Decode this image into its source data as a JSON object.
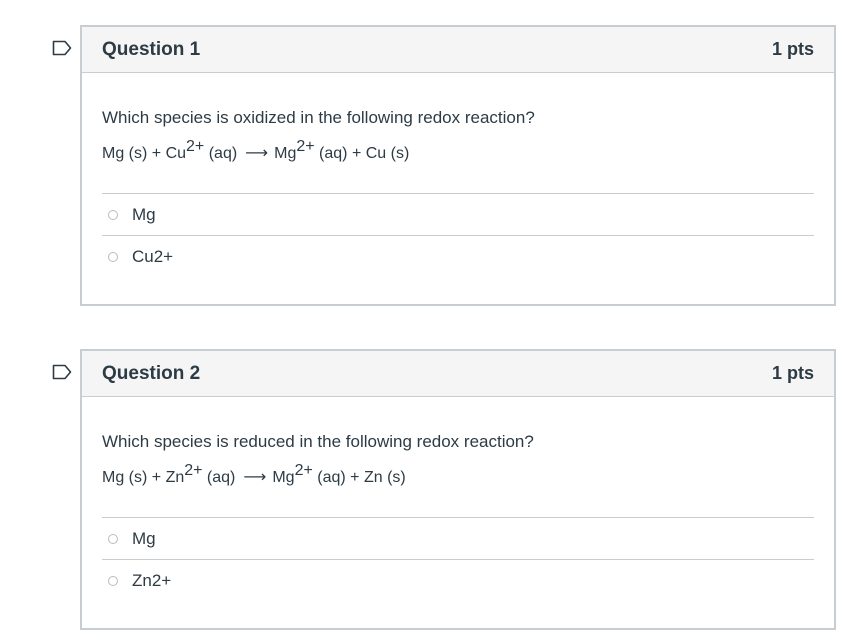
{
  "questions": [
    {
      "title": "Question 1",
      "points": "1 pts",
      "prompt": "Which species is oxidized in the following redox reaction?",
      "equation": {
        "reactant1": "Mg (s) + Cu",
        "reactant1_sup": "2+",
        "reactant1_state": " (aq)",
        "arrow": "⟶",
        "product1": "Mg",
        "product1_sup": "2+",
        "product1_rest": " (aq) + Cu (s)"
      },
      "options": [
        "Mg",
        "Cu2+"
      ]
    },
    {
      "title": "Question 2",
      "points": "1 pts",
      "prompt": "Which species is reduced in the following redox reaction?",
      "equation": {
        "reactant1": "Mg (s) + Zn",
        "reactant1_sup": "2+",
        "reactant1_state": " (aq)",
        "arrow": "⟶",
        "product1": "Mg",
        "product1_sup": "2+",
        "product1_rest": " (aq) + Zn (s)"
      },
      "options": [
        "Mg",
        "Zn2+"
      ]
    }
  ],
  "icons": {
    "flag": "flag-outline-icon",
    "radio": "radio-unchecked-icon"
  },
  "colors": {
    "text": "#2d3b45",
    "border": "#c7cdd1",
    "header_bg": "#f5f5f5"
  }
}
